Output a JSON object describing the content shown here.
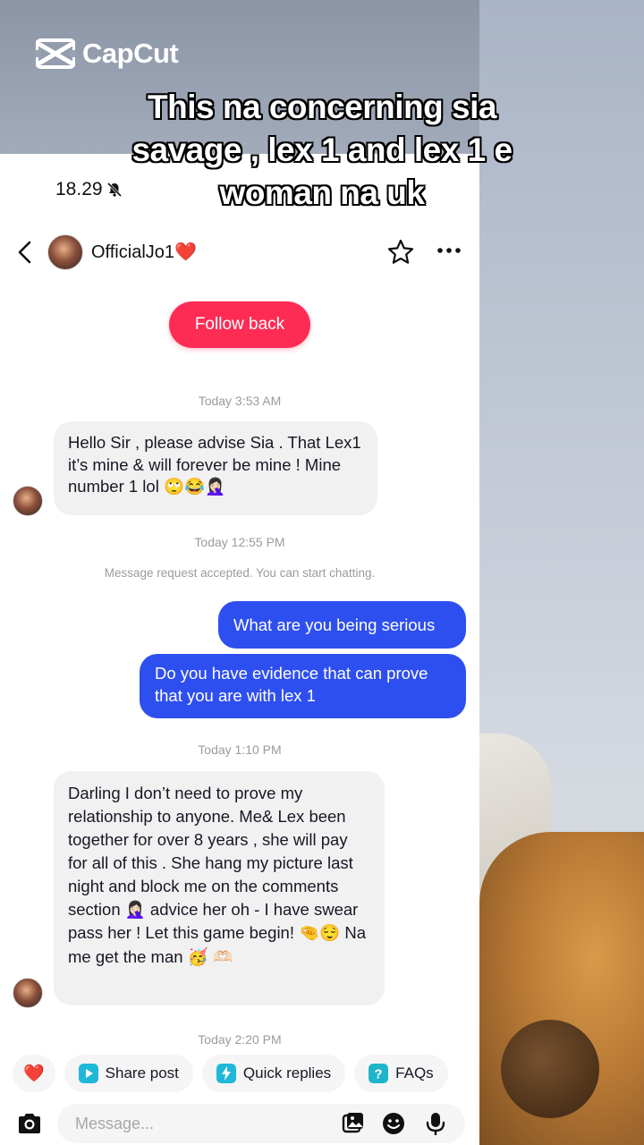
{
  "overlay": {
    "brand": "CapCut",
    "caption": "This na concerning sia savage , lex 1 and lex 1 e woman na uk"
  },
  "status_bar": {
    "time": "18.29",
    "silent_icon": "bell-slash-icon"
  },
  "header": {
    "username": "OfficialJo1❤️",
    "back_icon": "chevron-left-icon",
    "star_icon": "star-outline-icon",
    "more_icon": "more-horizontal-icon"
  },
  "follow_button": "Follow back",
  "messages": [
    {
      "type": "timestamp",
      "text": "Today 3:53 AM"
    },
    {
      "type": "incoming",
      "text": "Hello Sir , please advise Sia . That Lex1 it’s mine & will forever be mine ! Mine number 1 lol 🙄😂🤦🏻‍♀️"
    },
    {
      "type": "timestamp",
      "text": "Today 12:55 PM"
    },
    {
      "type": "system",
      "text": "Message request accepted. You can start chatting."
    },
    {
      "type": "outgoing",
      "text": "What are you being serious"
    },
    {
      "type": "outgoing",
      "text": "Do you have evidence that can prove that you are with lex 1"
    },
    {
      "type": "timestamp",
      "text": "Today 1:10 PM"
    },
    {
      "type": "incoming",
      "text": "Darling I don’t need to prove my relationship to anyone. Me& Lex been together for over 8 years , she will pay for all of this . She hang my picture last night and block me on the comments section 🤦🏻‍♀️ advice her oh - I have swear pass her ! Let this game begin! 🤏😌 Na me get the man 🥳 🫶🏻"
    },
    {
      "type": "timestamp",
      "text": "Today 2:20 PM"
    }
  ],
  "quick_actions": {
    "heart": "❤️",
    "share_post": "Share post",
    "quick_replies": "Quick replies",
    "faqs": "FAQs"
  },
  "composer": {
    "placeholder": "Message...",
    "camera_icon": "camera-icon",
    "image_icon": "image-icon",
    "emoji_icon": "emoji-icon",
    "mic_icon": "microphone-icon"
  },
  "colors": {
    "follow_button": "#fe2c55",
    "outgoing_bubble": "#2e4ff0",
    "incoming_bubble": "#f1f1f2",
    "share_icon": "#20b8d8",
    "faq_icon": "#1fb5c9"
  }
}
